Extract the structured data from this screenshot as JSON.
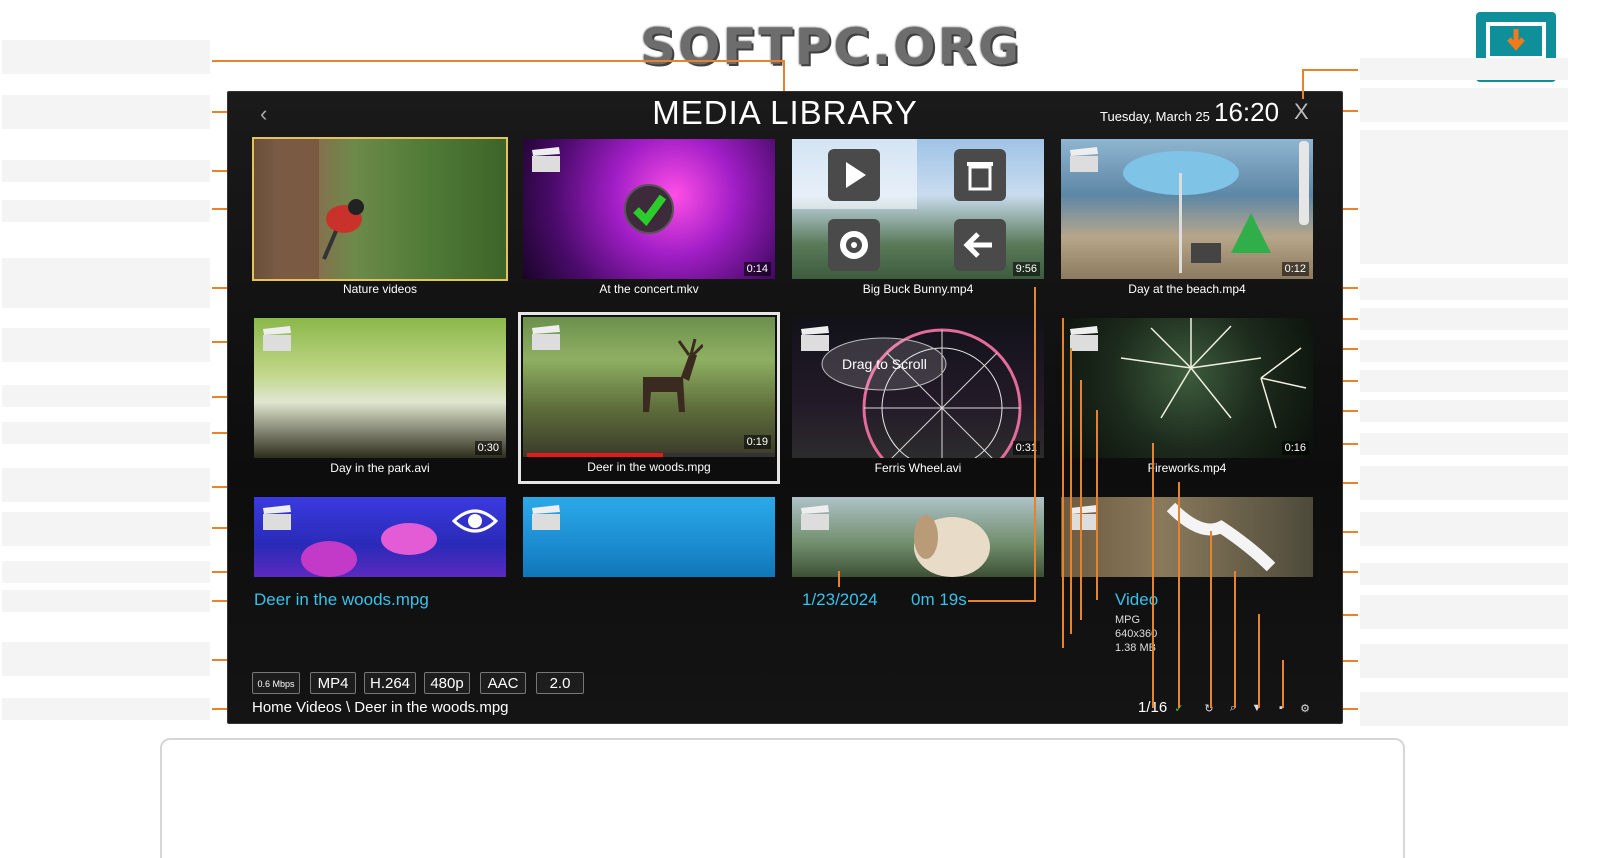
{
  "watermark": "SOFTPC.ORG",
  "header": {
    "title": "MEDIA LIBRARY",
    "date": "Tuesday, March 25",
    "time": "16:20",
    "back_glyph": "‹",
    "close_glyph": "X"
  },
  "tiles": [
    {
      "label": "Nature videos",
      "duration": ""
    },
    {
      "label": "At the concert.mkv",
      "duration": "0:14"
    },
    {
      "label": "Big Buck Bunny.mp4",
      "duration": "9:56"
    },
    {
      "label": "Day at the beach.mp4",
      "duration": "0:12"
    },
    {
      "label": "Day in the park.avi",
      "duration": "0:30"
    },
    {
      "label": "Deer in the woods.mpg",
      "duration": "0:19"
    },
    {
      "label": "Ferris Wheel.avi",
      "duration": "0:31"
    },
    {
      "label": "Fireworks.mp4",
      "duration": "0:16"
    }
  ],
  "drag_hint": "Drag to Scroll",
  "active_info": {
    "name": "Deer in the woods.mpg",
    "date": "1/23/2024",
    "length": "0m 19s",
    "type": "Video",
    "ext": "MPG",
    "resolution": "640x360",
    "size": "1.38 MB"
  },
  "badges": [
    "0.6 Mbps",
    "MP4",
    "H.264",
    "480p",
    "AAC",
    "2.0"
  ],
  "path": "Home Videos \\ Deer in the woods.mpg",
  "count": "1/16",
  "play_position": 0.55,
  "colors": {
    "accent": "#36c2ea",
    "leader": "#e8822d",
    "selection": "#e3c35a"
  },
  "icons": [
    "back-icon",
    "close-icon",
    "play-icon",
    "trash-icon",
    "gear-icon",
    "arrow-left-icon",
    "clapper-icon",
    "checkmark-icon",
    "eye-icon",
    "refresh-icon",
    "search-icon",
    "filter-icon",
    "delete-icon",
    "settings-icon",
    "download-monitor-icon"
  ]
}
